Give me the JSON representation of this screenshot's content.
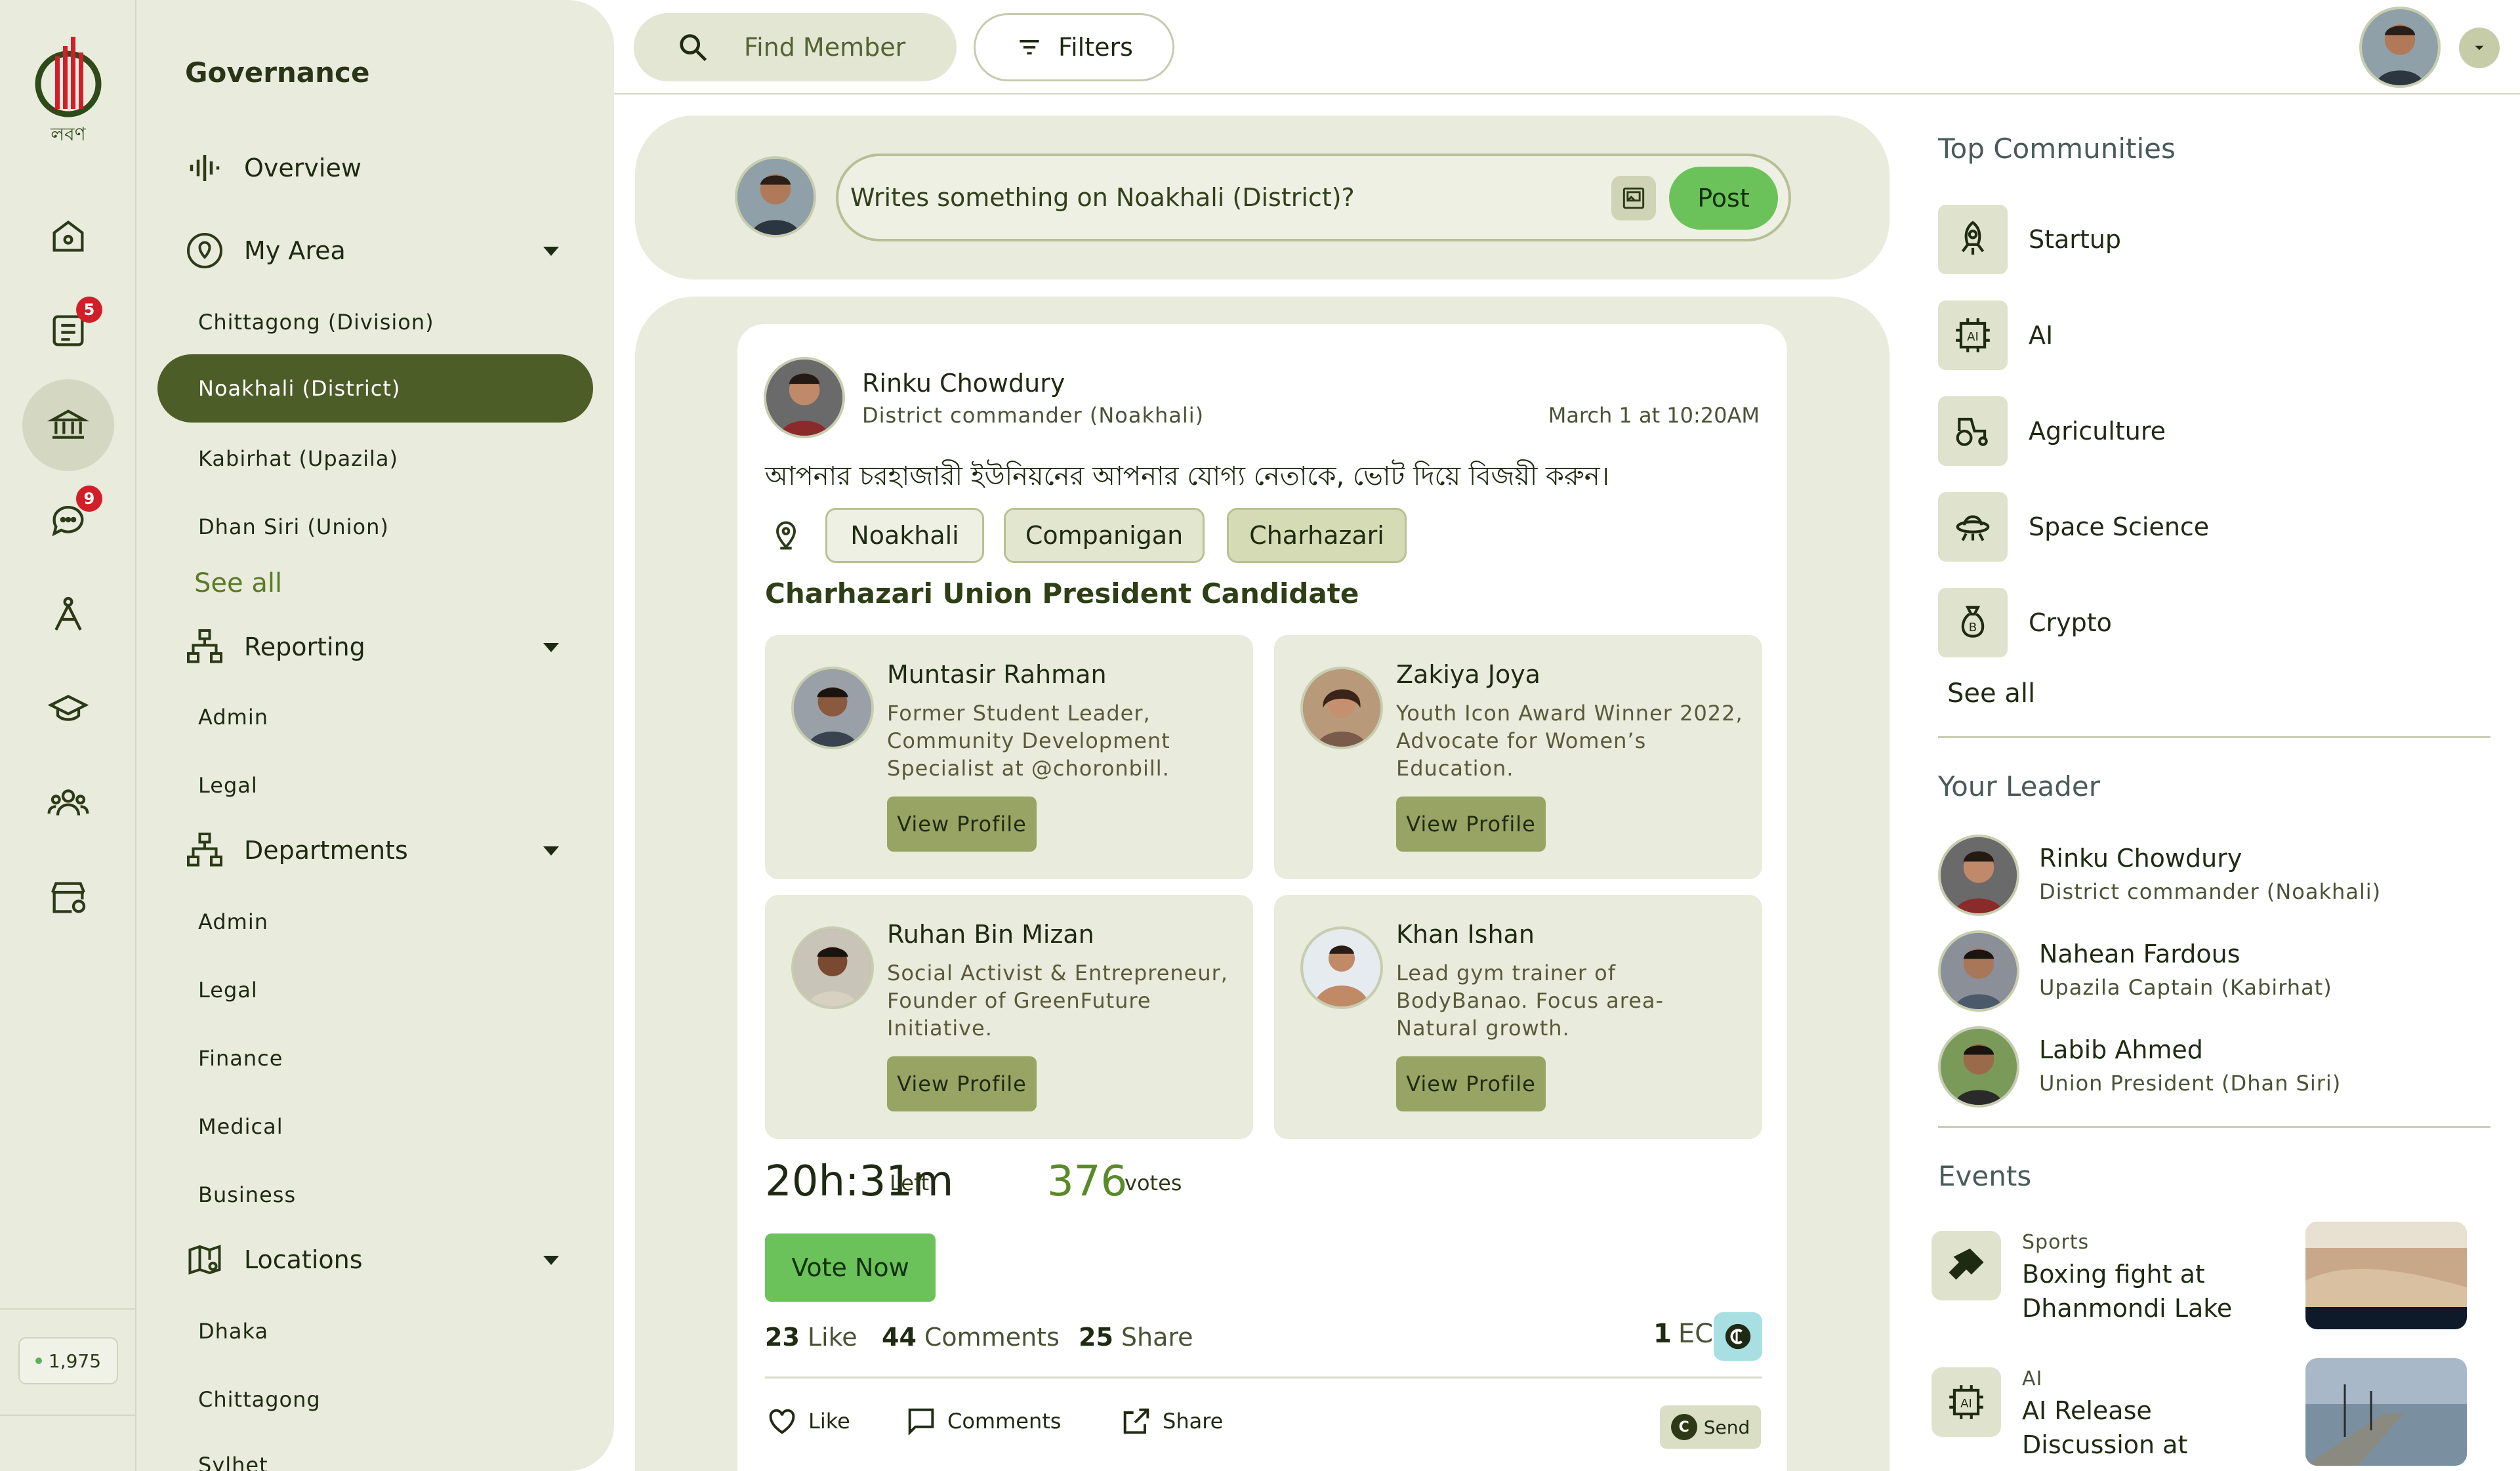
{
  "rail": {
    "badges": {
      "news": "5",
      "chat": "9"
    },
    "counter": "1,975"
  },
  "sidebar": {
    "title": "Governance",
    "overview": "Overview",
    "my_area": {
      "label": "My Area",
      "items": [
        "Chittagong (Division)",
        "Noakhali (District)",
        "Kabirhat (Upazila)",
        "Dhan Siri (Union)"
      ],
      "see_all": "See all"
    },
    "reporting": {
      "label": "Reporting",
      "items": [
        "Admin",
        "Legal"
      ]
    },
    "departments": {
      "label": "Departments",
      "items": [
        "Admin",
        "Legal",
        "Finance",
        "Medical",
        "Business"
      ]
    },
    "locations": {
      "label": "Locations",
      "items": [
        "Dhaka",
        "Chittagong",
        "Sylhet"
      ]
    }
  },
  "topbar": {
    "search_placeholder": "Find Member",
    "filters_label": "Filters"
  },
  "composer": {
    "placeholder": "Writes something on Noakhali (District)?",
    "post_label": "Post"
  },
  "post": {
    "author": "Rinku Chowdury",
    "role": "District commander (Noakhali)",
    "date": "March 1 at 10:20AM",
    "body": "আপনার চরহাজারী ইউনিয়নের আপনার যোগ্য নেতাকে, ভোট দিয়ে বিজয়ী করুন।",
    "tags": [
      "Noakhali",
      "Companigan",
      "Charhazari"
    ],
    "candidates_title": "Charhazari Union President Candidate",
    "candidates": [
      {
        "name": "Muntasir Rahman",
        "desc": "Former Student Leader, Community Development Specialist at @choronbill.",
        "button": "View Profile"
      },
      {
        "name": "Zakiya Joya",
        "desc": "Youth Icon Award Winner 2022, Advocate for Women’s Education.",
        "button": "View Profile"
      },
      {
        "name": "Ruhan Bin Mizan",
        "desc": "Social Activist & Entrepreneur, Founder of GreenFuture Initiative.",
        "button": "View Profile"
      },
      {
        "name": "Khan Ishan",
        "desc": "Lead gym trainer of BodyBanao. Focus area- Natural growth.",
        "button": "View Profile"
      }
    ],
    "time_left": "20h:31m",
    "time_left_label": "Left",
    "votes": "376",
    "votes_label": "votes",
    "vote_button": "Vote Now",
    "likes_count": "23",
    "likes_label": "Like",
    "comments_count": "44",
    "comments_label": "Comments",
    "shares_count": "25",
    "shares_label": "Share",
    "ec_count": "1",
    "ec_label": "EC",
    "actions": {
      "like": "Like",
      "comments": "Comments",
      "share": "Share",
      "send": "Send"
    }
  },
  "right": {
    "communities_title": "Top Communities",
    "communities": [
      "Startup",
      "AI",
      "Agriculture",
      "Space Science",
      "Crypto"
    ],
    "communities_see_all": "See all",
    "leader_title": "Your Leader",
    "leaders": [
      {
        "name": "Rinku Chowdury",
        "role": "District commander (Noakhali)"
      },
      {
        "name": "Nahean Fardous",
        "role": "Upazila Captain (Kabirhat)"
      },
      {
        "name": "Labib Ahmed",
        "role": "Union President (Dhan Siri)"
      }
    ],
    "events_title": "Events",
    "events": [
      {
        "category": "Sports",
        "title": "Boxing fight at Dhanmondi Lake"
      },
      {
        "category": "AI",
        "title": "AI Release Discussion at"
      }
    ]
  },
  "colors": {
    "accent_dark": "#4c5d28",
    "accent_green": "#6cc25a",
    "panel": "#e9ebdc",
    "badge_red": "#d11f2a"
  }
}
